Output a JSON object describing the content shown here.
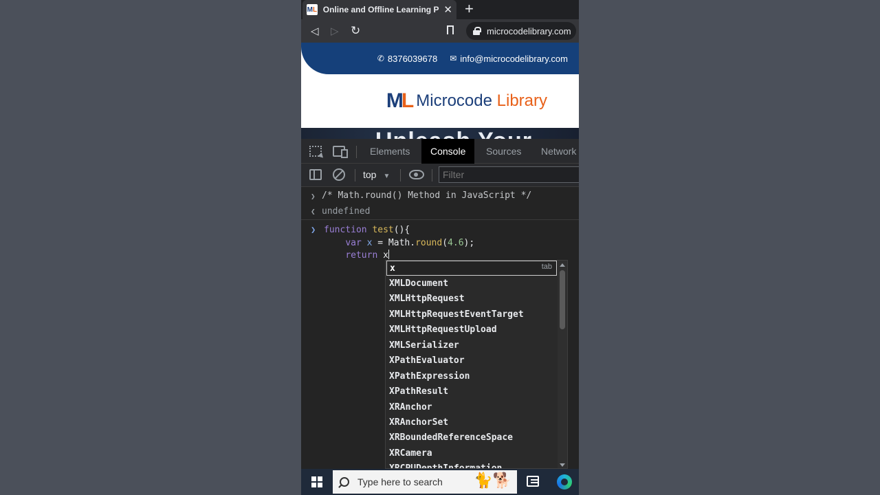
{
  "browser": {
    "tab_title": "Online and Offline Learning Platfo",
    "tab_close": "✕",
    "new_tab": "+",
    "url": "microcodelibrary.com",
    "back": "◁",
    "forward": "▷",
    "reload": "↻"
  },
  "website": {
    "phone": "8376039678",
    "email": "info@microcodelibrary.com",
    "logo_mark_m": "M",
    "logo_mark_l": "L",
    "logo_name": "Microcode",
    "logo_name_2": "Library",
    "hero_text": "Unleash Your"
  },
  "devtools": {
    "tabs": [
      "Elements",
      "Console",
      "Sources",
      "Network"
    ],
    "active_tab": "Console",
    "context": "top",
    "filter_placeholder": "Filter"
  },
  "console": {
    "lines": [
      {
        "type": "input",
        "text": "/* Math.round() Method in JavaScript */"
      },
      {
        "type": "output",
        "text": "undefined"
      }
    ],
    "code": {
      "line1_kw": "function",
      "line1_fn": "test",
      "line1_rest": "(){",
      "line2_kw": "var",
      "line2_var": "x",
      "line2_eq": " = Math.",
      "line2_fn": "round",
      "line2_open": "(",
      "line2_num": "4.6",
      "line2_close": ");",
      "line3_kw": "return",
      "line3_text": "x"
    },
    "autocomplete": {
      "typed": "x",
      "hint": "tab",
      "items": [
        "XMLDocument",
        "XMLHttpRequest",
        "XMLHttpRequestEventTarget",
        "XMLHttpRequestUpload",
        "XMLSerializer",
        "XPathEvaluator",
        "XPathExpression",
        "XPathResult",
        "XRAnchor",
        "XRAnchorSet",
        "XRBoundedReferenceSpace",
        "XRCamera",
        "XRCPUDepthInformation"
      ]
    }
  },
  "taskbar": {
    "search_placeholder": "Type here to search"
  }
}
